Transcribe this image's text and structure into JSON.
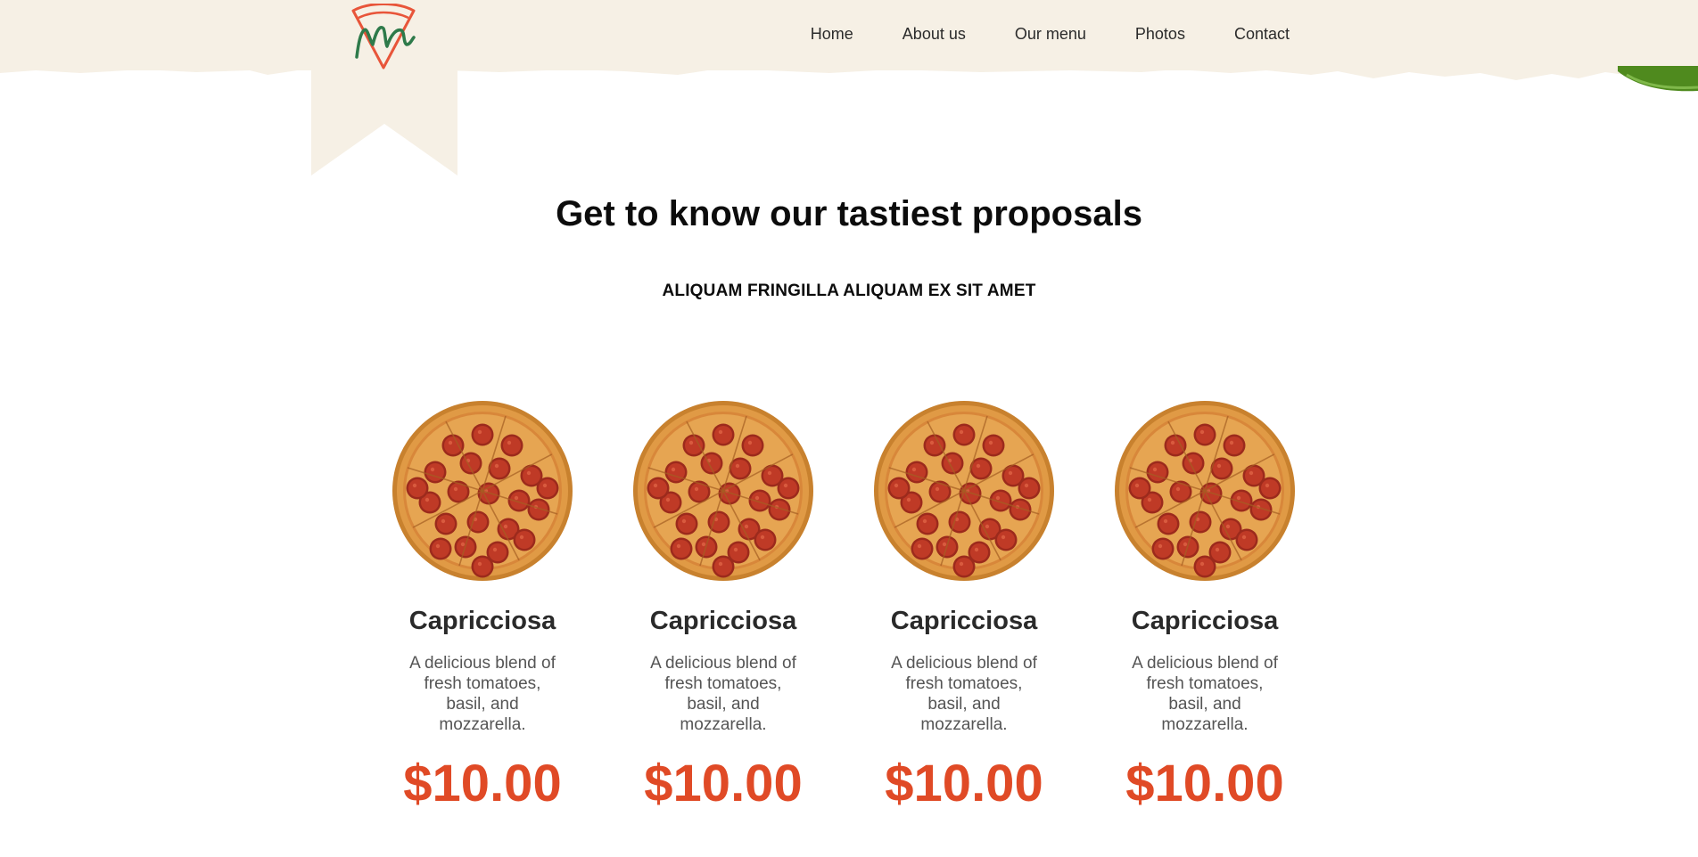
{
  "nav": {
    "items": [
      "Home",
      "About us",
      "Our menu",
      "Photos",
      "Contact"
    ]
  },
  "main": {
    "title": "Get to know our tastiest proposals",
    "subtitle": "ALIQUAM FRINGILLA ALIQUAM EX SIT AMET"
  },
  "products": [
    {
      "name": "Capricciosa",
      "description": "A delicious blend of fresh tomatoes, basil, and mozzarella.",
      "price": "$10.00"
    },
    {
      "name": "Capricciosa",
      "description": "A delicious blend of fresh tomatoes, basil, and mozzarella.",
      "price": "$10.00"
    },
    {
      "name": "Capricciosa",
      "description": "A delicious blend of fresh tomatoes, basil, and mozzarella.",
      "price": "$10.00"
    },
    {
      "name": "Capricciosa",
      "description": "A delicious blend of fresh tomatoes, basil, and mozzarella.",
      "price": "$10.00"
    }
  ],
  "colors": {
    "header_bg": "#f6f0e5",
    "price": "#e04a26",
    "logo_red": "#e8553a",
    "logo_green": "#2e7a4a",
    "leaf_green": "#4f8a1e"
  },
  "icons": {
    "logo": "pizza-slice-logo-icon",
    "product_image": "pepperoni-pizza-image"
  }
}
